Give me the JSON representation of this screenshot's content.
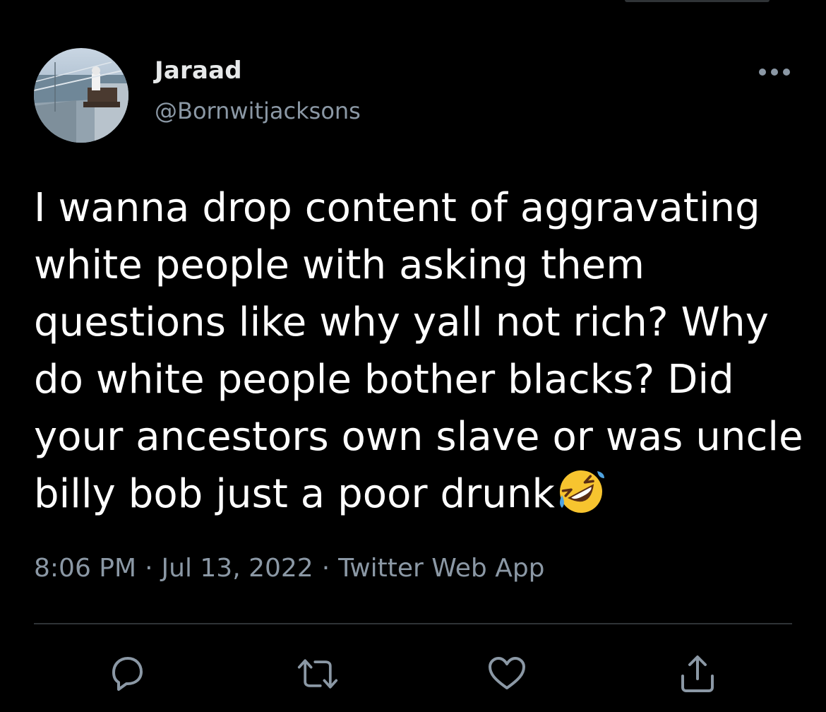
{
  "tweet": {
    "author_name": "Jaraad",
    "author_handle": "@Bornwitjacksons",
    "text": "I wanna drop content of aggravating white people with asking them questions like why yall not rich? Why do white people bother blacks? Did your ancestors own slave or was uncle billy bob just a poor drunk",
    "emoji": "rolling-on-the-floor-laughing",
    "time": "8:06 PM",
    "separator": "·",
    "date": "Jul 13, 2022",
    "source": "Twitter Web App"
  },
  "header": {
    "more_icon": "more-horizontal-icon"
  },
  "actions": [
    {
      "icon": "reply-icon"
    },
    {
      "icon": "retweet-icon"
    },
    {
      "icon": "like-icon"
    },
    {
      "icon": "share-icon"
    }
  ],
  "colors": {
    "background": "#000000",
    "primary_text": "#ffffff",
    "name_text": "#e7e9ea",
    "secondary_text": "#8b98a5",
    "divider": "#2f3336"
  }
}
